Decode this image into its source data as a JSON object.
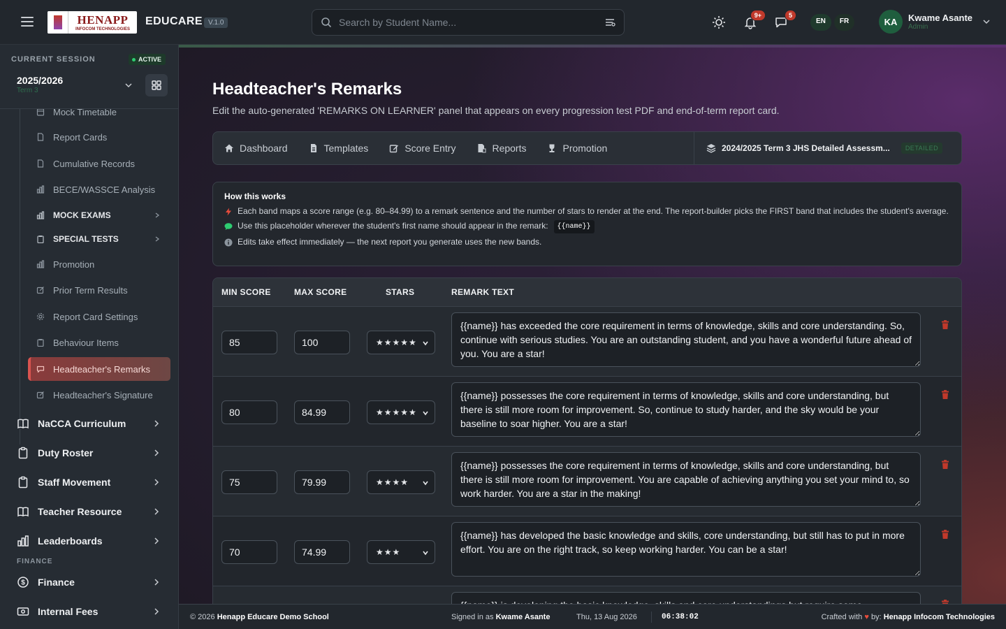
{
  "app": {
    "logo_text": "HENAPP",
    "logo_subtext": "INFOCOM TECHNOLOGIES",
    "brand": "EDUCARE",
    "version": "V.1.0"
  },
  "header": {
    "search_placeholder": "Search by Student Name...",
    "notifications_badge": "9+",
    "messages_badge": "5",
    "lang_en": "EN",
    "lang_fr": "FR",
    "user_initials": "KA",
    "user_name": "Kwame Asante",
    "user_role": "Admin"
  },
  "session": {
    "label": "CURRENT SESSION",
    "status": "ACTIVE",
    "year": "2025/2026",
    "term": "Term 3"
  },
  "sidebar": {
    "sub_items": [
      {
        "label": "Mock Timetable",
        "icon": "calendar-icon"
      },
      {
        "label": "Report Cards",
        "icon": "document-icon"
      },
      {
        "label": "Cumulative Records",
        "icon": "document-icon"
      },
      {
        "label": "BECE/WASSCE Analysis",
        "icon": "chart-icon"
      },
      {
        "label": "MOCK EXAMS",
        "icon": "chart-icon"
      },
      {
        "label": "SPECIAL TESTS",
        "icon": "clipboard-icon"
      },
      {
        "label": "Promotion",
        "icon": "chart-icon"
      },
      {
        "label": "Prior Term Results",
        "icon": "edit-icon"
      },
      {
        "label": "Report Card Settings",
        "icon": "gear-icon"
      },
      {
        "label": "Behaviour Items",
        "icon": "clipboard-icon"
      },
      {
        "label": "Headteacher's Remarks",
        "icon": "comment-icon"
      },
      {
        "label": "Headteacher's Signature",
        "icon": "edit-icon"
      }
    ],
    "main_items": [
      {
        "label": "NaCCA Curriculum",
        "icon": "book-icon"
      },
      {
        "label": "Duty Roster",
        "icon": "clipboard-icon"
      },
      {
        "label": "Staff Movement",
        "icon": "clipboard-icon"
      },
      {
        "label": "Teacher Resource",
        "icon": "book-icon"
      },
      {
        "label": "Leaderboards",
        "icon": "chart-icon"
      }
    ],
    "finance_label": "FINANCE",
    "finance_items": [
      {
        "label": "Finance",
        "icon": "dollar-icon"
      },
      {
        "label": "Internal Fees",
        "icon": "money-icon"
      }
    ]
  },
  "page": {
    "title": "Headteacher's Remarks",
    "description": "Edit the auto-generated 'REMARKS ON LEARNER' panel that appears on every progression test PDF and end-of-term report card."
  },
  "tabs": [
    {
      "label": "Dashboard",
      "icon": "home-icon"
    },
    {
      "label": "Templates",
      "icon": "file-icon"
    },
    {
      "label": "Score Entry",
      "icon": "edit-icon"
    },
    {
      "label": "Reports",
      "icon": "report-icon"
    },
    {
      "label": "Promotion",
      "icon": "trophy-icon"
    }
  ],
  "template": {
    "label": "2024/2025 Term 3 JHS Detailed Assessm...",
    "badge": "DETAILED"
  },
  "how": {
    "title": "How this works",
    "line1": "Each band maps a score range (e.g. 80–84.99) to a remark sentence and the number of stars to render at the end. The report-builder picks the FIRST band that includes the student's average.",
    "line2": "Use this placeholder wherever the student's first name should appear in the remark:",
    "placeholder_code": "{{name}}",
    "line3": "Edits take effect immediately — the next report you generate uses the new bands."
  },
  "table": {
    "headers": {
      "min": "MIN SCORE",
      "max": "MAX SCORE",
      "stars": "STARS",
      "remark": "REMARK TEXT"
    },
    "rows": [
      {
        "min": "85",
        "max": "100",
        "stars": "★★★★★",
        "remark": "{{name}} has exceeded the core requirement in terms of knowledge, skills and core understanding. So, continue with serious studies. You are an outstanding student, and you have a wonderful future ahead of you. You are a star!"
      },
      {
        "min": "80",
        "max": "84.99",
        "stars": "★★★★★",
        "remark": "{{name}} possesses the core requirement in terms of knowledge, skills and core understanding, but there is still more room for improvement. So, continue to study harder, and the sky would be your baseline to soar higher. You are a star!"
      },
      {
        "min": "75",
        "max": "79.99",
        "stars": "★★★★",
        "remark": "{{name}} possesses the core requirement in terms of knowledge, skills and core understanding, but there is still more room for improvement. You are capable of achieving anything you set your mind to, so work harder. You are a star in the making!"
      },
      {
        "min": "70",
        "max": "74.99",
        "stars": "★★★",
        "remark": "{{name}} has developed the basic knowledge and skills, core understanding, but still has to put in more effort. You are on the right track, so keep working harder. You can be a star!"
      },
      {
        "min": "",
        "max": "",
        "stars": "",
        "remark": "{{name}} is developing the basic knowledge, skills and core understandings but require some"
      }
    ]
  },
  "footer": {
    "copyright_prefix": "© 2026",
    "school": "Henapp Educare Demo School",
    "signed_prefix": "Signed in as",
    "signed_user": "Kwame Asante",
    "date": "Thu, 13 Aug 2026",
    "time": "06:38:02",
    "crafted_prefix": "Crafted with",
    "crafted_by": "by:",
    "company": "Henapp Infocom Technologies"
  },
  "colors": {
    "accent": "#d9534f",
    "active_green": "#2ecc71",
    "heart": "#e74c3c"
  }
}
